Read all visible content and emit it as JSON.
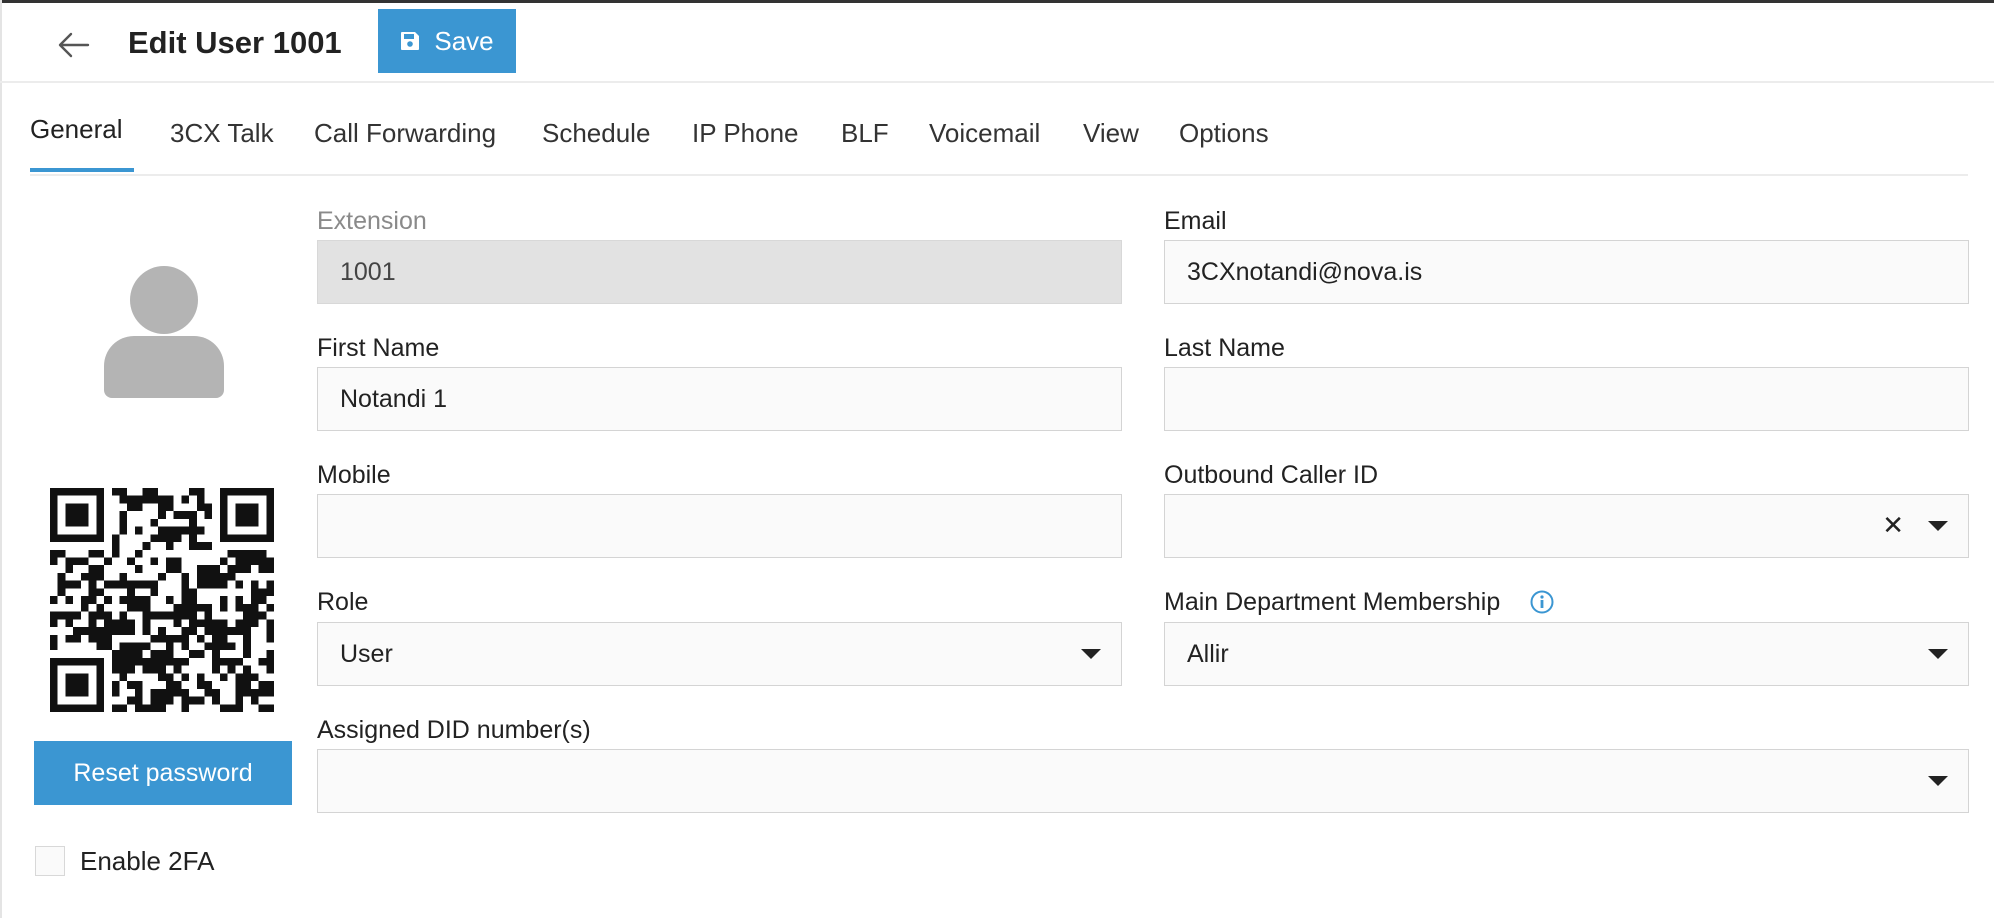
{
  "header": {
    "title": "Edit User 1001",
    "save_label": "Save"
  },
  "tabs": [
    {
      "label": "General",
      "active": true
    },
    {
      "label": "3CX Talk"
    },
    {
      "label": "Call Forwarding"
    },
    {
      "label": "Schedule"
    },
    {
      "label": "IP Phone"
    },
    {
      "label": "BLF"
    },
    {
      "label": "Voicemail"
    },
    {
      "label": "View"
    },
    {
      "label": "Options"
    }
  ],
  "form": {
    "extension": {
      "label": "Extension",
      "value": "1001"
    },
    "email": {
      "label": "Email",
      "value": "3CXnotandi@nova.is"
    },
    "first_name": {
      "label": "First Name",
      "value": "Notandi 1"
    },
    "last_name": {
      "label": "Last Name",
      "value": ""
    },
    "mobile": {
      "label": "Mobile",
      "value": ""
    },
    "outbound_caller_id": {
      "label": "Outbound Caller ID",
      "value": "",
      "clear_glyph": "✕"
    },
    "role": {
      "label": "Role",
      "value": "User"
    },
    "main_department": {
      "label": "Main Department Membership",
      "value": "Allir"
    },
    "assigned_did": {
      "label": "Assigned DID number(s)",
      "value": ""
    }
  },
  "sidebar": {
    "reset_password_label": "Reset password",
    "enable_2fa_label": "Enable 2FA",
    "enable_2fa_checked": false
  },
  "colors": {
    "accent": "#3b96d2",
    "disabled_field": "#e2e2e2",
    "field_bg": "#fafafa"
  },
  "icons": {
    "back": "arrow-left-icon",
    "save": "floppy-disk-icon",
    "avatar": "user-silhouette-icon",
    "qr": "qr-code",
    "info": "info-circle-icon"
  }
}
